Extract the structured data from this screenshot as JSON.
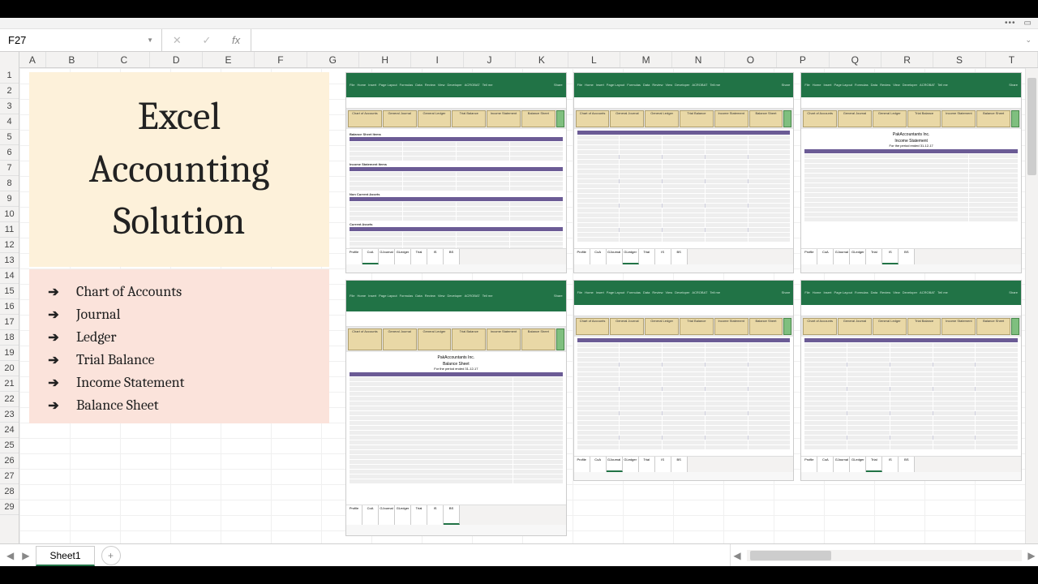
{
  "namebox": "F27",
  "fx_label": "fx",
  "columns": [
    "A",
    "B",
    "C",
    "D",
    "E",
    "F",
    "G",
    "H",
    "I",
    "J",
    "K",
    "L",
    "M",
    "N",
    "O",
    "P",
    "Q",
    "R",
    "S",
    "T"
  ],
  "rows": [
    "1",
    "2",
    "3",
    "4",
    "5",
    "6",
    "7",
    "8",
    "9",
    "10",
    "11",
    "12",
    "13",
    "14",
    "15",
    "16",
    "17",
    "18",
    "19",
    "20",
    "21",
    "22",
    "23",
    "24",
    "25",
    "26",
    "27",
    "28",
    "29"
  ],
  "title_lines": [
    "Excel",
    "Accounting",
    "Solution"
  ],
  "features": [
    "Chart of Accounts",
    "Journal",
    "Ledger",
    "Trial Balance",
    "Income Statement",
    "Balance Sheet"
  ],
  "sheet_tab": "Sheet1",
  "thumb_menu": [
    "File",
    "Home",
    "Insert",
    "Page Layout",
    "Formulas",
    "Data",
    "Review",
    "View",
    "Developer",
    "ACROBAT",
    "Tell me"
  ],
  "thumb_share": "Share",
  "thumb_nav_tabs": [
    "Chart of Accounts",
    "General Journal",
    "General Ledger",
    "Trial Balance",
    "Income Statement",
    "Balance Sheet"
  ],
  "thumb_sheets": [
    "Profile",
    "CoA",
    "GJournal",
    "GLedger",
    "Trial",
    "IS",
    "BS"
  ],
  "thumbs": {
    "t1": {
      "active_sheet": "CoA",
      "sections": [
        "Balance Sheet Items",
        "Income Statement Items",
        "Non Current Assets",
        "Current Assets"
      ]
    },
    "t2": {
      "active_sheet": "GLedger"
    },
    "t3": {
      "active_sheet": "IS",
      "title": "PakAccountants Inc.",
      "subtitle": "Income Statement",
      "period": "For the period ended 31-12-17"
    },
    "t4": {
      "active_sheet": "GJournal"
    },
    "t5": {
      "active_sheet": "Trial"
    },
    "t6": {
      "active_sheet": "BS",
      "title": "PakAccountants Inc.",
      "subtitle": "Balance Sheet",
      "period": "For the period ended 31-12-17"
    }
  }
}
